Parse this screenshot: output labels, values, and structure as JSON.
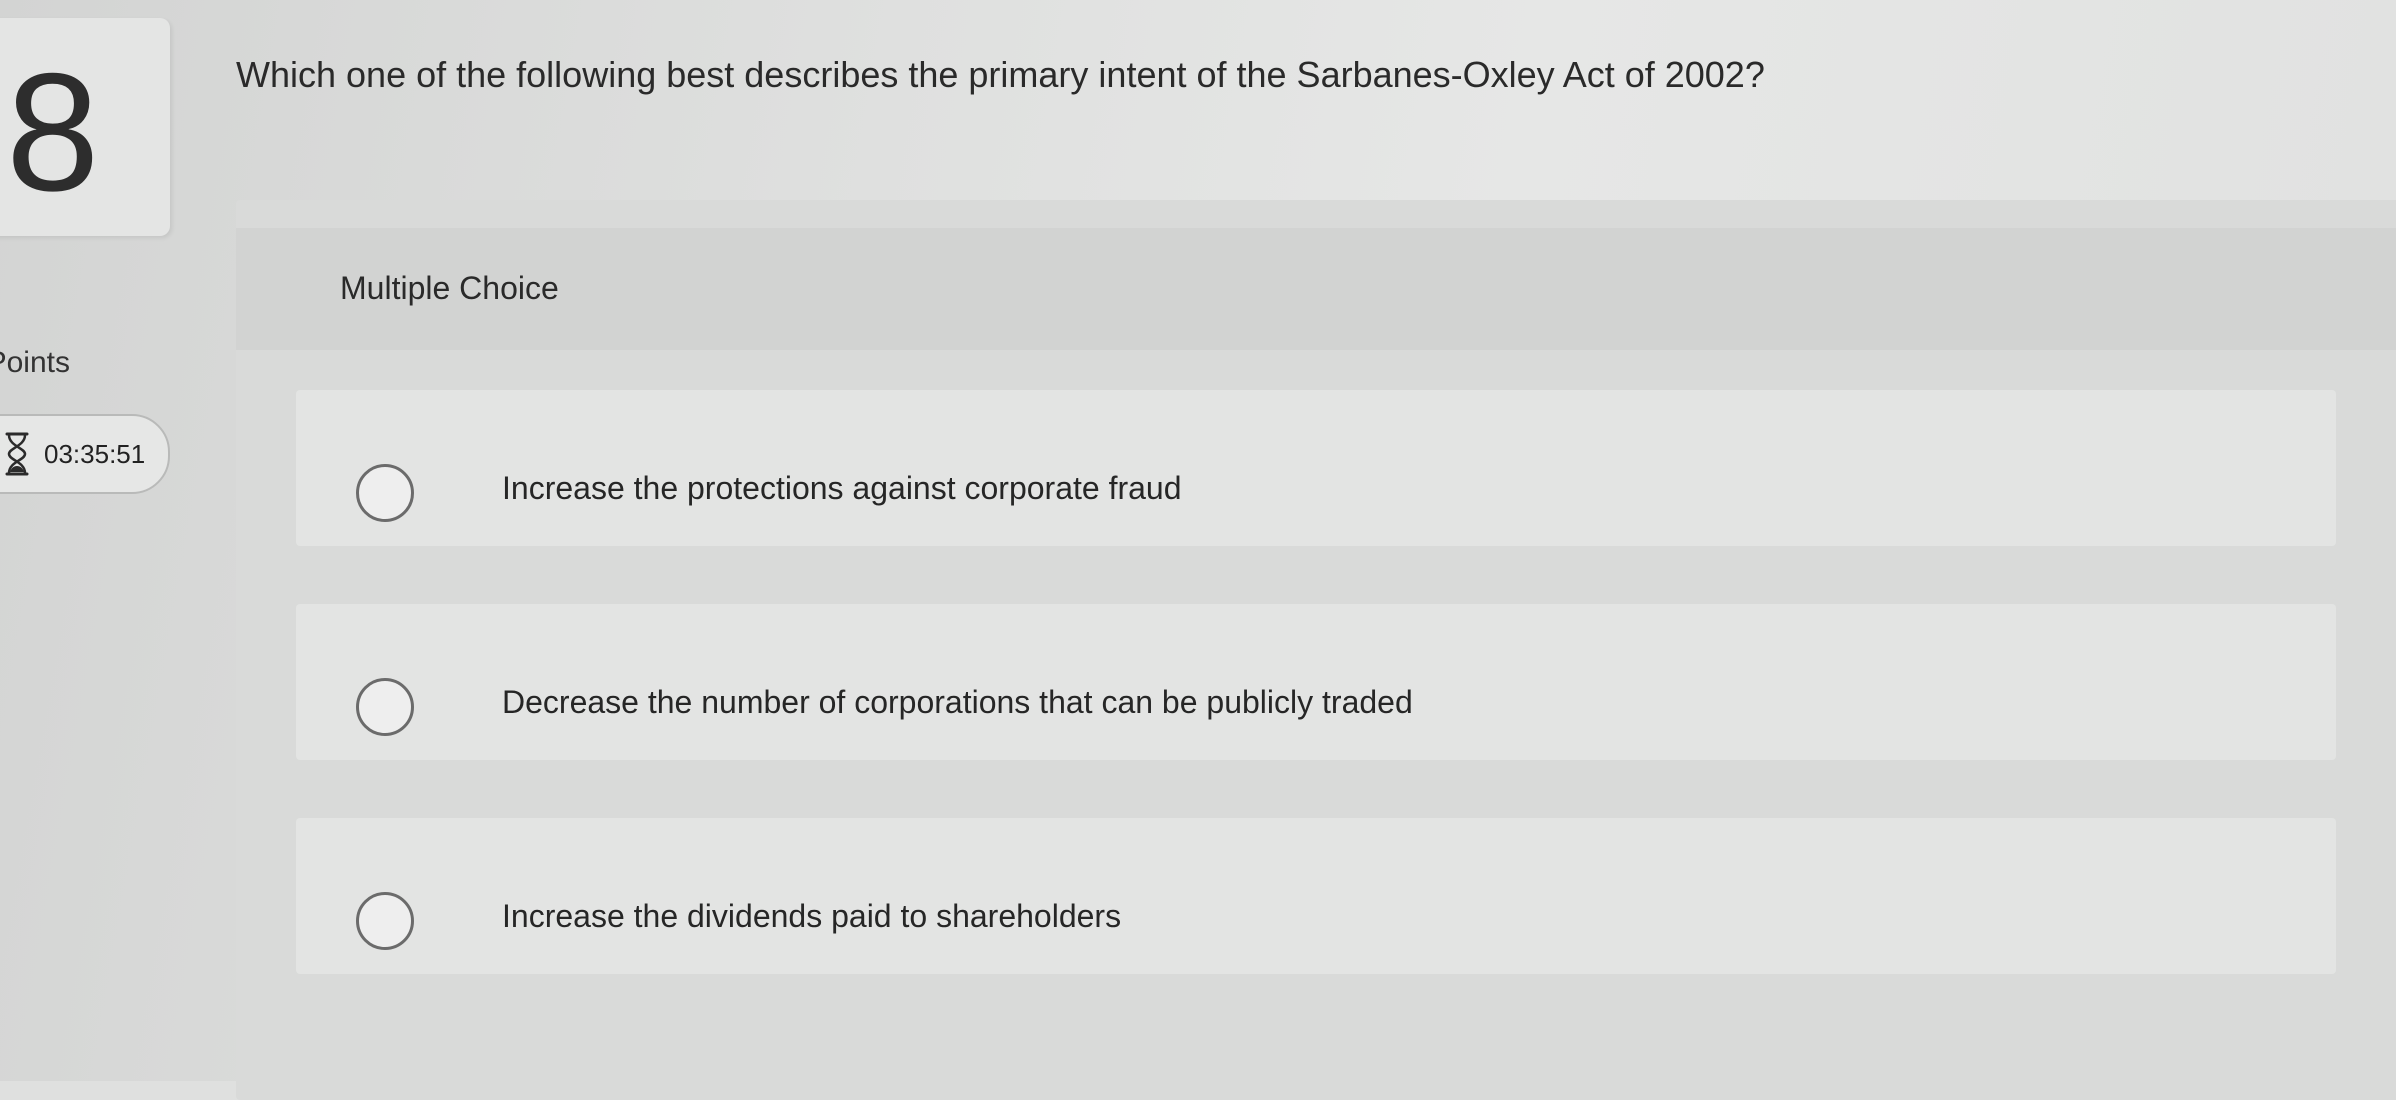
{
  "question": {
    "number": "8",
    "points_label": "Points",
    "timer": "03:35:51",
    "text": "Which one of the following best describes the primary intent of the Sarbanes-Oxley Act of 2002?"
  },
  "answer_panel": {
    "type_label": "Multiple Choice",
    "options": [
      {
        "label": "Increase the protections against corporate fraud",
        "selected": false
      },
      {
        "label": "Decrease the number of corporations that can be publicly traded",
        "selected": false
      },
      {
        "label": "Increase the dividends paid to shareholders",
        "selected": false
      }
    ]
  },
  "icons": {
    "timer": "hourglass-icon",
    "radio": "radio-unselected-icon"
  }
}
